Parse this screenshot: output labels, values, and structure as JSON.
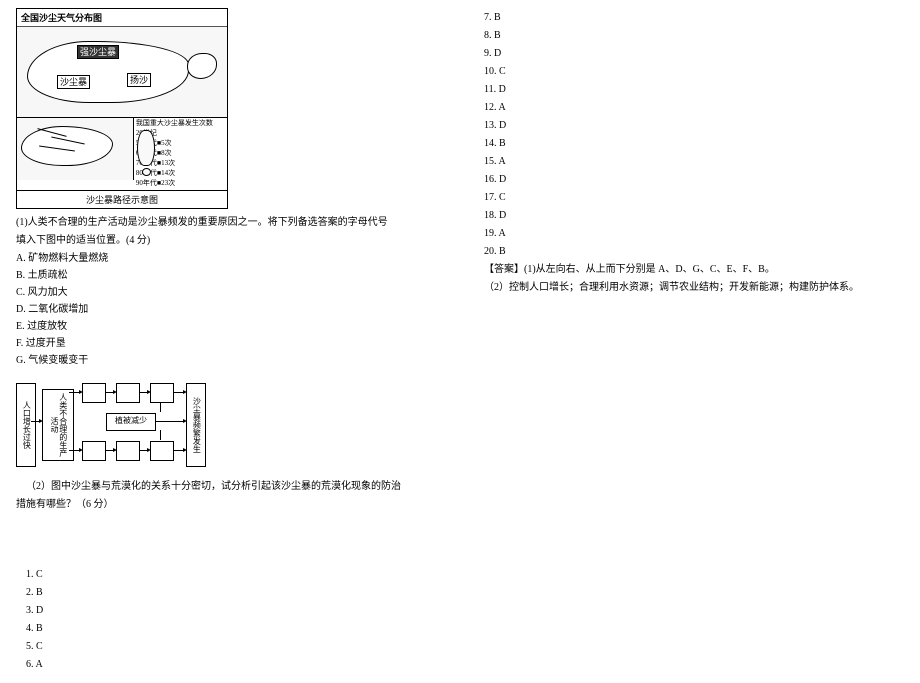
{
  "figureTop": {
    "title": "全国沙尘天气分布图",
    "label1": "强沙尘暴",
    "label2": "沙尘暴",
    "label3": "扬沙",
    "rightBoxHeader": "我国重大沙尘暴发生次数",
    "rows": [
      "20世纪",
      "50年代■5次",
      "60年代■8次",
      "70年代■13次",
      "80年代■14次",
      "90年代■23次"
    ],
    "caption": "沙尘暴路径示意图"
  },
  "q1": {
    "stem_a": "(1)人类不合理的生产活动是沙尘暴频发的重要原因之一。将下列备选答案的字母代号",
    "stem_b": "填入下图中的适当位置。(4 分)",
    "opts": {
      "A": "A. 矿物燃料大量燃烧",
      "B": "B. 土质疏松",
      "C": "C. 风力加大",
      "D": "D. 二氧化碳增加",
      "E": "E. 过度放牧",
      "F": "F. 过度开垦",
      "G": "G. 气候变暖变干"
    }
  },
  "diagram": {
    "left": "人口增长过快",
    "mid": "人类不合理的生产活动",
    "center": "植被减少",
    "right": "沙尘暴频繁发生"
  },
  "q2": {
    "stem_a": "（2）图中沙尘暴与荒漠化的关系十分密切，试分析引起该沙尘暴的荒漠化现象的防治",
    "stem_b": "措施有哪些？（6 分）"
  },
  "answers": {
    "list": [
      "1. C",
      "2. B",
      "3. D",
      "4. B",
      "5. C",
      "6. A",
      "7. B",
      "8. B",
      "9. D",
      "10. C",
      "11. D",
      "12. A",
      "13. D",
      "14. B",
      "15. A",
      "16. D",
      "17. C",
      "18. D",
      "19. A",
      "20. B"
    ],
    "free1": "【答案】(1)从左向右、从上而下分别是 A、D、G、C、E、F、B。",
    "free2": "（2）控制人口增长；合理利用水资源；调节农业结构；开发新能源；构建防护体系。"
  }
}
